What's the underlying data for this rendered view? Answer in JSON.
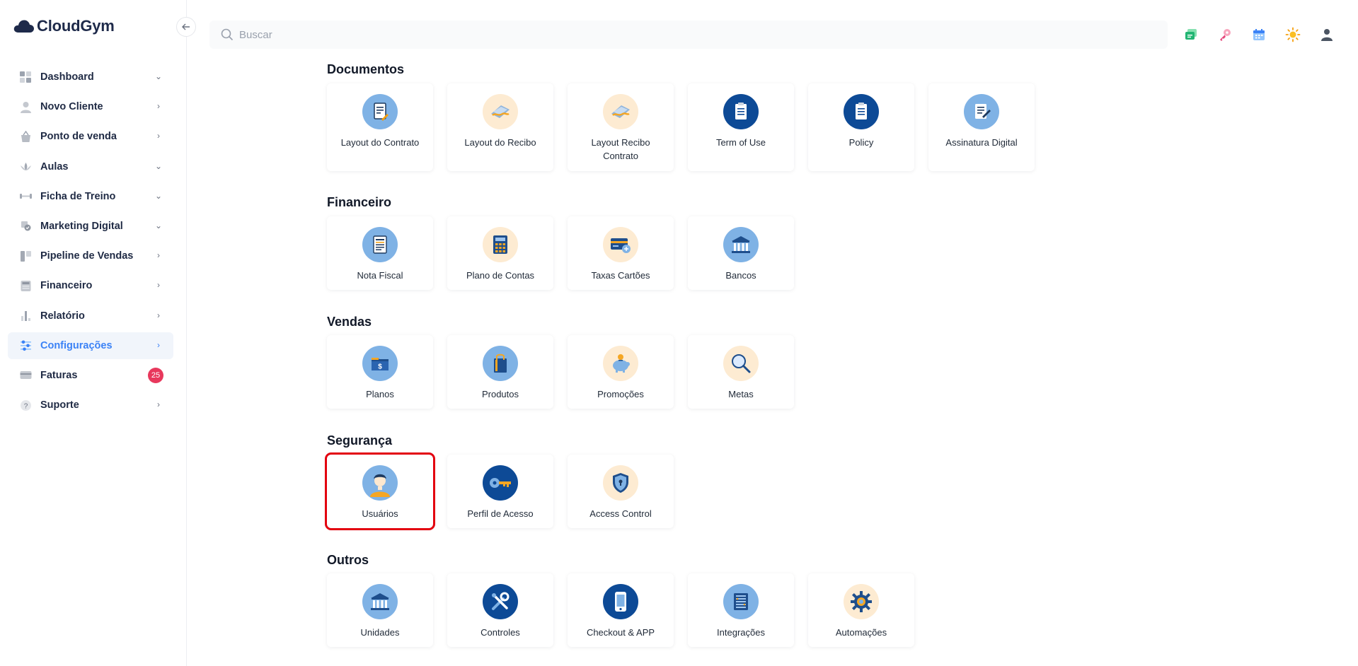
{
  "app": {
    "logo_text": "CloudGym"
  },
  "sidebar": {
    "items": [
      {
        "label": "Dashboard",
        "icon": "dashboard-icon",
        "chevron": "down"
      },
      {
        "label": "Novo Cliente",
        "icon": "user-icon",
        "chevron": "right"
      },
      {
        "label": "Ponto de venda",
        "icon": "basket-icon",
        "chevron": "right"
      },
      {
        "label": "Aulas",
        "icon": "yoga-icon",
        "chevron": "down"
      },
      {
        "label": "Ficha de Treino",
        "icon": "dumbbell-icon",
        "chevron": "down"
      },
      {
        "label": "Marketing Digital",
        "icon": "megaphone-icon",
        "chevron": "down"
      },
      {
        "label": "Pipeline de Vendas",
        "icon": "pipeline-icon",
        "chevron": "right"
      },
      {
        "label": "Financeiro",
        "icon": "calculator-icon",
        "chevron": "right"
      },
      {
        "label": "Relatório",
        "icon": "bar-chart-icon",
        "chevron": "right"
      },
      {
        "label": "Configurações",
        "icon": "sliders-icon",
        "chevron": "right",
        "active": true
      },
      {
        "label": "Faturas",
        "icon": "credit-card-icon",
        "badge": "25"
      },
      {
        "label": "Suporte",
        "icon": "help-icon",
        "chevron": "right"
      }
    ]
  },
  "search": {
    "placeholder": "Buscar"
  },
  "topbar": {
    "icons": [
      "chat-icon",
      "key-icon",
      "calendar-icon",
      "sun-icon",
      "user-profile-icon"
    ]
  },
  "sections": [
    {
      "title": "Documentos",
      "cards": [
        {
          "label": "Layout do Contrato",
          "icon": "contract-icon",
          "style": "light"
        },
        {
          "label": "Layout do Recibo",
          "icon": "receipt-icon",
          "style": "peach"
        },
        {
          "label": "Layout Recibo Contrato",
          "icon": "receipt-contract-icon",
          "style": "peach"
        },
        {
          "label": "Term of Use",
          "icon": "clipboard-icon",
          "style": "dark"
        },
        {
          "label": "Policy",
          "icon": "policy-icon",
          "style": "dark"
        },
        {
          "label": "Assinatura Digital",
          "icon": "signature-icon",
          "style": "light"
        }
      ]
    },
    {
      "title": "Financeiro",
      "cards": [
        {
          "label": "Nota Fiscal",
          "icon": "invoice-icon",
          "style": "light"
        },
        {
          "label": "Plano de Contas",
          "icon": "calculator-icon",
          "style": "peach"
        },
        {
          "label": "Taxas Cartões",
          "icon": "card-fee-icon",
          "style": "peach"
        },
        {
          "label": "Bancos",
          "icon": "bank-icon",
          "style": "light"
        }
      ]
    },
    {
      "title": "Vendas",
      "cards": [
        {
          "label": "Planos",
          "icon": "dollar-folder-icon",
          "style": "light"
        },
        {
          "label": "Produtos",
          "icon": "shopping-bag-icon",
          "style": "light"
        },
        {
          "label": "Promoções",
          "icon": "piggy-bank-icon",
          "style": "peach"
        },
        {
          "label": "Metas",
          "icon": "magnifier-icon",
          "style": "peach"
        }
      ]
    },
    {
      "title": "Segurança",
      "cards": [
        {
          "label": "Usuários",
          "icon": "user-avatar-icon",
          "style": "light",
          "highlight": true
        },
        {
          "label": "Perfil de Acesso",
          "icon": "access-key-icon",
          "style": "dark"
        },
        {
          "label": "Access Control",
          "icon": "shield-lock-icon",
          "style": "peach"
        }
      ]
    },
    {
      "title": "Outros",
      "cards": [
        {
          "label": "Unidades",
          "icon": "building-icon",
          "style": "light"
        },
        {
          "label": "Controles",
          "icon": "tools-icon",
          "style": "dark"
        },
        {
          "label": "Checkout & APP",
          "icon": "smartphone-icon",
          "style": "dark"
        },
        {
          "label": "Integrações",
          "icon": "integration-icon",
          "style": "light"
        },
        {
          "label": "Automações",
          "icon": "gear-automation-icon",
          "style": "peach"
        }
      ]
    }
  ]
}
